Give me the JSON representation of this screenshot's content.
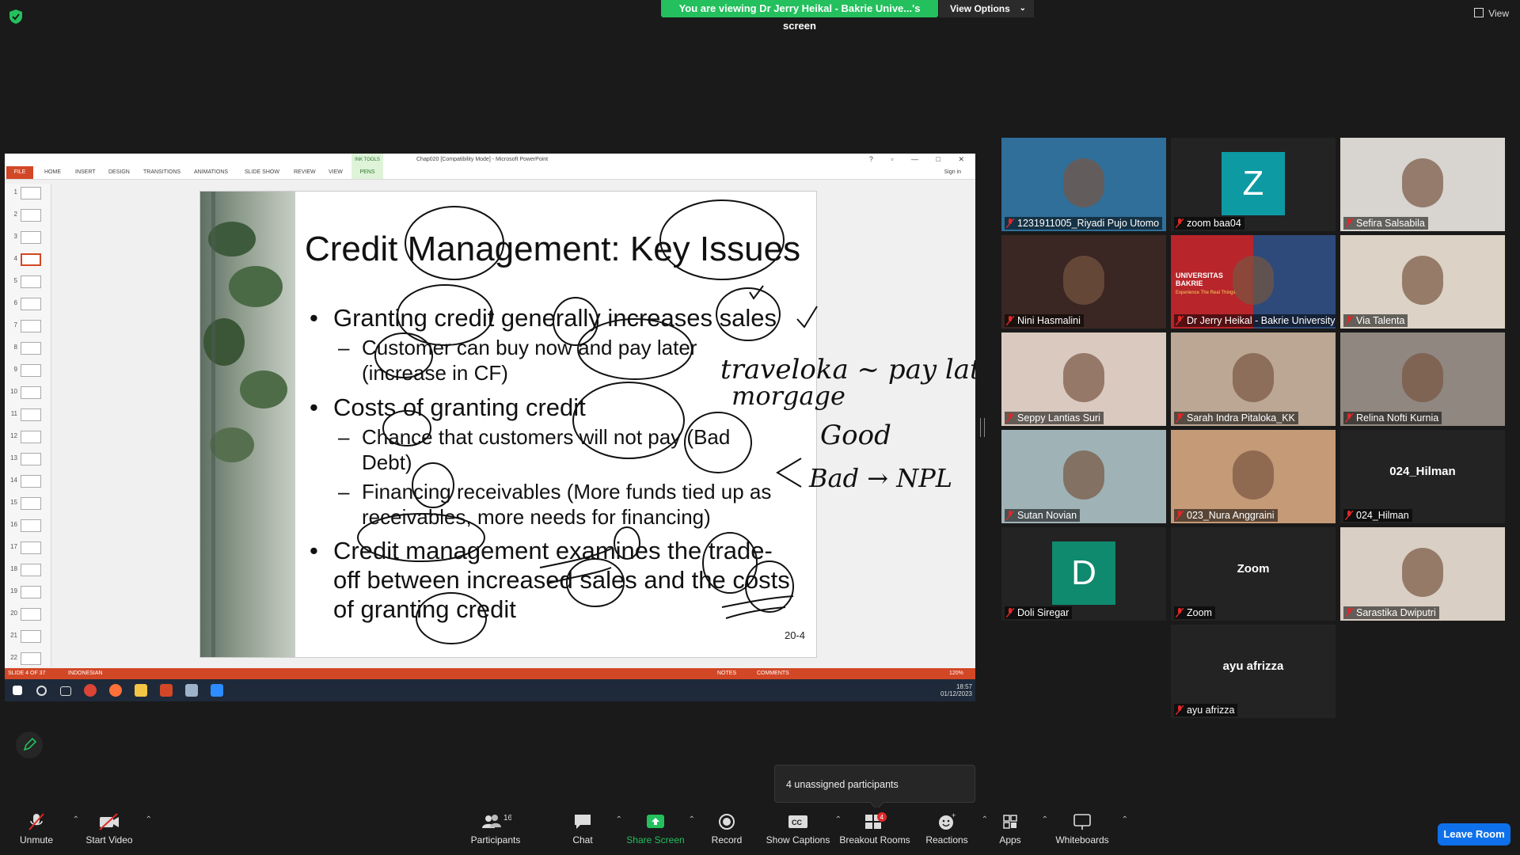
{
  "banner": {
    "text": "You are viewing Dr Jerry Heikal - Bakrie Unive...'s screen"
  },
  "view_options": {
    "label": "View Options"
  },
  "view_button": {
    "label": "View"
  },
  "powerpoint": {
    "window_title": "Chap020 [Compatibility Mode] - Microsoft PowerPoint",
    "ink_tools": "INK TOOLS",
    "tabs": [
      "FILE",
      "HOME",
      "INSERT",
      "DESIGN",
      "TRANSITIONS",
      "ANIMATIONS",
      "SLIDE SHOW",
      "REVIEW",
      "VIEW",
      "PENS"
    ],
    "sign_in": "Sign in",
    "thumbnails": [
      "1",
      "2",
      "3",
      "4",
      "5",
      "6",
      "7",
      "8",
      "9",
      "10",
      "11",
      "12",
      "13",
      "14",
      "15",
      "16",
      "17",
      "18",
      "19",
      "20",
      "21",
      "22"
    ],
    "status_slide": "SLIDE 4 OF 37",
    "status_lang": "INDONESIAN",
    "status_notes": "NOTES",
    "status_comments": "COMMENTS",
    "zoom": "120%",
    "time": "18:57",
    "date": "01/12/2023"
  },
  "slide": {
    "title": "Credit Management: Key Issues",
    "bullets": [
      {
        "level": 1,
        "text": "Granting credit generally increases sales"
      },
      {
        "level": 2,
        "text": "Customer can buy now and pay later"
      },
      {
        "level": 2,
        "text": "(increase in CF)"
      },
      {
        "level": 1,
        "text": "Costs of granting credit"
      },
      {
        "level": 2,
        "text": "Chance that customers will not pay (Bad"
      },
      {
        "level": 2,
        "text": "Debt)"
      },
      {
        "level": 2,
        "text": "Financing receivables (More funds tied up as"
      },
      {
        "level": 2,
        "text": "receivables, more needs for financing)"
      },
      {
        "level": 1,
        "text": "Credit management examines the trade-"
      },
      {
        "level": 1,
        "text": "off between increased sales and the costs"
      },
      {
        "level": 1,
        "text": "of granting credit"
      }
    ],
    "number": "20-4",
    "handwriting": [
      "traveloka ~ pay later",
      "morgage",
      "Good",
      "Bad → NPL"
    ]
  },
  "participants": [
    {
      "name": "1231911005_Riyadi Pujo Utomo",
      "type": "video",
      "color": "#2f6f9a"
    },
    {
      "name": "zoom baa04",
      "type": "avatar",
      "letter": "Z",
      "color": "#0d9aa3"
    },
    {
      "name": "Sefira Salsabila",
      "type": "video",
      "color": "#d8d4cf"
    },
    {
      "name": "Nini Hasmalini",
      "type": "video",
      "color": "#3a2622"
    },
    {
      "name": "Dr Jerry Heikal - Bakrie University",
      "type": "video",
      "color": "#b8252a",
      "speaking": true,
      "caption": "UNIVERSITAS BAKRIE",
      "subcaption": "Experience The Real Things"
    },
    {
      "name": "Via Talenta",
      "type": "video",
      "color": "#dcd2c6"
    },
    {
      "name": "Seppy Lantias Suri",
      "type": "video",
      "color": "#d9c9bf"
    },
    {
      "name": "Sarah Indra Pitaloka_KK",
      "type": "video",
      "color": "#bba793"
    },
    {
      "name": "Relina Nofti Kurnia",
      "type": "video",
      "color": "#8f8780"
    },
    {
      "name": "Sutan Novian",
      "type": "video",
      "color": "#9fb3b6"
    },
    {
      "name": "023_Nura Anggraini",
      "type": "video",
      "color": "#c59a77"
    },
    {
      "name": "024_Hilman",
      "type": "name",
      "display": "024_Hilman"
    },
    {
      "name": "Doli Siregar",
      "type": "avatar",
      "letter": "D",
      "color": "#0f8a6e"
    },
    {
      "name": "Zoom",
      "type": "name",
      "display": "Zoom"
    },
    {
      "name": "Sarastika Dwiputri",
      "type": "photo",
      "color": "#d9cfc4"
    },
    {
      "name": "ayu afrizza",
      "type": "name",
      "display": "ayu afrizza"
    }
  ],
  "unassigned": "4 unassigned participants",
  "toolbar": {
    "unmute": "Unmute",
    "start_video": "Start Video",
    "participants": "Participants",
    "participants_count": "16",
    "chat": "Chat",
    "share_screen": "Share Screen",
    "record": "Record",
    "show_captions": "Show Captions",
    "breakout_rooms": "Breakout Rooms",
    "breakout_badge": "4",
    "reactions": "Reactions",
    "apps": "Apps",
    "whiteboards": "Whiteboards",
    "leave": "Leave Room"
  },
  "colors": {
    "accent_green": "#23c05d",
    "leave_blue": "#0e71eb",
    "mute_red": "#e02828",
    "ppt_orange": "#d24726"
  }
}
